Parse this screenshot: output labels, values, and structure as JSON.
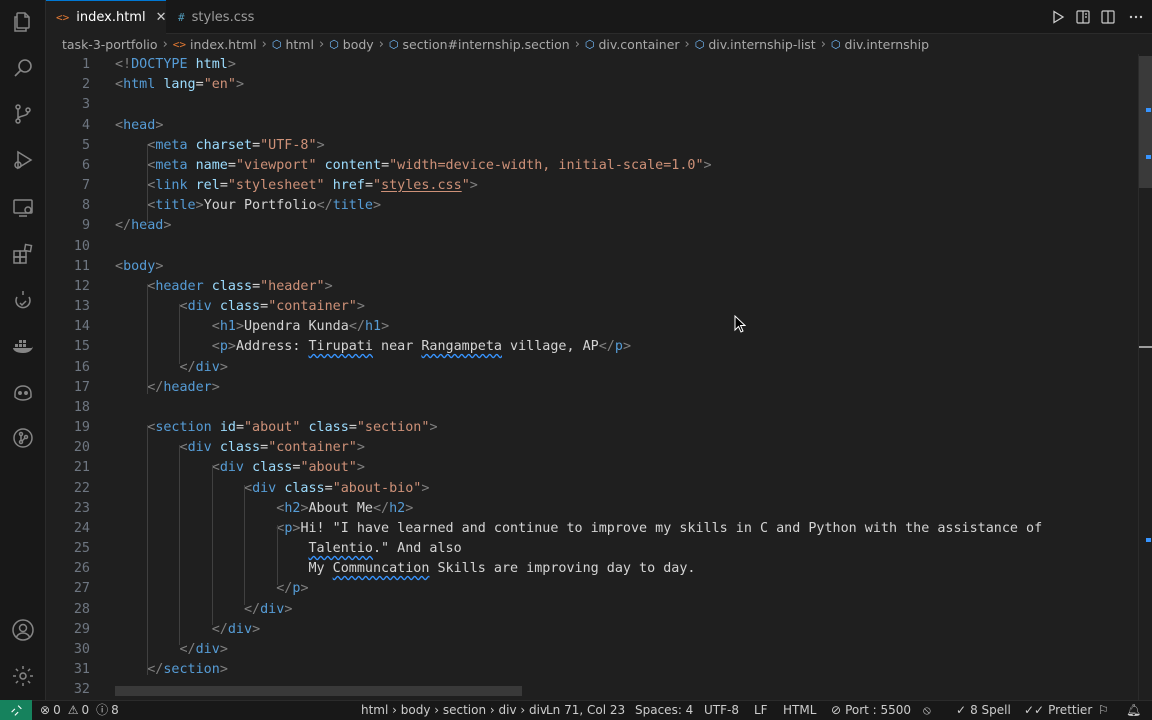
{
  "tabs": [
    {
      "label": "index.html",
      "icon": "<>",
      "active": true
    },
    {
      "label": "styles.css",
      "icon": "#",
      "active": false
    }
  ],
  "breadcrumbs": [
    "task-3-portfolio",
    "index.html",
    "html",
    "body",
    "section#internship.section",
    "div.container",
    "div.internship-list",
    "div.internship"
  ],
  "code_lines": [
    {
      "n": "1",
      "html": "<span class='tk-p'>&lt;!</span><span class='tk-t'>DOCTYPE</span> <span class='tk-a'>html</span><span class='tk-p'>&gt;</span>"
    },
    {
      "n": "2",
      "html": "<span class='tk-p'>&lt;</span><span class='tk-t'>html</span> <span class='tk-a'>lang</span><span class='tk-x'>=</span><span class='tk-s'>\"en\"</span><span class='tk-p'>&gt;</span>"
    },
    {
      "n": "3",
      "html": ""
    },
    {
      "n": "4",
      "html": "<span class='tk-p'>&lt;</span><span class='tk-t'>head</span><span class='tk-p'>&gt;</span>"
    },
    {
      "n": "5",
      "html": "    <span class='tk-p'>&lt;</span><span class='tk-t'>meta</span> <span class='tk-a'>charset</span><span class='tk-x'>=</span><span class='tk-s'>\"UTF-8\"</span><span class='tk-p'>&gt;</span>"
    },
    {
      "n": "6",
      "html": "    <span class='tk-p'>&lt;</span><span class='tk-t'>meta</span> <span class='tk-a'>name</span><span class='tk-x'>=</span><span class='tk-s'>\"viewport\"</span> <span class='tk-a'>content</span><span class='tk-x'>=</span><span class='tk-s'>\"width=device-width, initial-scale=1.0\"</span><span class='tk-p'>&gt;</span>"
    },
    {
      "n": "7",
      "html": "    <span class='tk-p'>&lt;</span><span class='tk-t'>link</span> <span class='tk-a'>rel</span><span class='tk-x'>=</span><span class='tk-s'>\"stylesheet\"</span> <span class='tk-a'>href</span><span class='tk-x'>=</span><span class='tk-s'>\"<span style='text-decoration:underline;text-underline-offset:2px'>styles.css</span>\"</span><span class='tk-p'>&gt;</span>"
    },
    {
      "n": "8",
      "html": "    <span class='tk-p'>&lt;</span><span class='tk-t'>title</span><span class='tk-p'>&gt;</span><span class='tk-x'>Your Portfolio</span><span class='tk-p'>&lt;/</span><span class='tk-t'>title</span><span class='tk-p'>&gt;</span>"
    },
    {
      "n": "9",
      "html": "<span class='tk-p'>&lt;/</span><span class='tk-t'>head</span><span class='tk-p'>&gt;</span>"
    },
    {
      "n": "10",
      "html": ""
    },
    {
      "n": "11",
      "html": "<span class='tk-p'>&lt;</span><span class='tk-t'>body</span><span class='tk-p'>&gt;</span>"
    },
    {
      "n": "12",
      "html": "    <span class='tk-p'>&lt;</span><span class='tk-t'>header</span> <span class='tk-a'>class</span><span class='tk-x'>=</span><span class='tk-s'>\"header\"</span><span class='tk-p'>&gt;</span>"
    },
    {
      "n": "13",
      "html": "        <span class='tk-p'>&lt;</span><span class='tk-t'>div</span> <span class='tk-a'>class</span><span class='tk-x'>=</span><span class='tk-s'>\"container\"</span><span class='tk-p'>&gt;</span>"
    },
    {
      "n": "14",
      "html": "            <span class='tk-p'>&lt;</span><span class='tk-t'>h1</span><span class='tk-p'>&gt;</span><span class='tk-x'>Upendra Kunda</span><span class='tk-p'>&lt;/</span><span class='tk-t'>h1</span><span class='tk-p'>&gt;</span>"
    },
    {
      "n": "15",
      "html": "            <span class='tk-p'>&lt;</span><span class='tk-t'>p</span><span class='tk-p'>&gt;</span><span class='tk-x'>Address: <span class='squig'>Tirupati</span> near <span class='squig'>Rangampeta</span> village, AP</span><span class='tk-p'>&lt;/</span><span class='tk-t'>p</span><span class='tk-p'>&gt;</span>"
    },
    {
      "n": "16",
      "html": "        <span class='tk-p'>&lt;/</span><span class='tk-t'>div</span><span class='tk-p'>&gt;</span>"
    },
    {
      "n": "17",
      "html": "    <span class='tk-p'>&lt;/</span><span class='tk-t'>header</span><span class='tk-p'>&gt;</span>"
    },
    {
      "n": "18",
      "html": ""
    },
    {
      "n": "19",
      "html": "    <span class='tk-p'>&lt;</span><span class='tk-t'>section</span> <span class='tk-a'>id</span><span class='tk-x'>=</span><span class='tk-s'>\"about\"</span> <span class='tk-a'>class</span><span class='tk-x'>=</span><span class='tk-s'>\"section\"</span><span class='tk-p'>&gt;</span>"
    },
    {
      "n": "20",
      "html": "        <span class='tk-p'>&lt;</span><span class='tk-t'>div</span> <span class='tk-a'>class</span><span class='tk-x'>=</span><span class='tk-s'>\"container\"</span><span class='tk-p'>&gt;</span>"
    },
    {
      "n": "21",
      "html": "            <span class='tk-p'>&lt;</span><span class='tk-t'>div</span> <span class='tk-a'>class</span><span class='tk-x'>=</span><span class='tk-s'>\"about\"</span><span class='tk-p'>&gt;</span>"
    },
    {
      "n": "22",
      "html": "                <span class='tk-p'>&lt;</span><span class='tk-t'>div</span> <span class='tk-a'>class</span><span class='tk-x'>=</span><span class='tk-s'>\"about-bio\"</span><span class='tk-p'>&gt;</span>"
    },
    {
      "n": "23",
      "html": "                    <span class='tk-p'>&lt;</span><span class='tk-t'>h2</span><span class='tk-p'>&gt;</span><span class='tk-x'>About Me</span><span class='tk-p'>&lt;/</span><span class='tk-t'>h2</span><span class='tk-p'>&gt;</span>"
    },
    {
      "n": "24",
      "html": "                    <span class='tk-p'>&lt;</span><span class='tk-t'>p</span><span class='tk-p'>&gt;</span><span class='tk-x'>Hi! \"I have learned and continue to improve my skills in C and Python with the assistance of</span>"
    },
    {
      "n": "25",
      "html": "                        <span class='tk-x'><span class='squig'>Talentio</span>.\" And also</span>"
    },
    {
      "n": "26",
      "html": "                        <span class='tk-x'>My <span class='squig'>Communcation</span> Skills are improving day to day.</span>"
    },
    {
      "n": "27",
      "html": "                    <span class='tk-p'>&lt;/</span><span class='tk-t'>p</span><span class='tk-p'>&gt;</span>"
    },
    {
      "n": "28",
      "html": "                <span class='tk-p'>&lt;/</span><span class='tk-t'>div</span><span class='tk-p'>&gt;</span>"
    },
    {
      "n": "29",
      "html": "            <span class='tk-p'>&lt;/</span><span class='tk-t'>div</span><span class='tk-p'>&gt;</span>"
    },
    {
      "n": "30",
      "html": "        <span class='tk-p'>&lt;/</span><span class='tk-t'>div</span><span class='tk-p'>&gt;</span>"
    },
    {
      "n": "31",
      "html": "    <span class='tk-p'>&lt;/</span><span class='tk-t'>section</span><span class='tk-p'>&gt;</span>"
    },
    {
      "n": "32",
      "html": ""
    }
  ],
  "status": {
    "errors": "0",
    "warnings": "0",
    "info": "8",
    "path": "html › body › section › div › div",
    "position": "Ln 71, Col 23",
    "spaces": "Spaces: 4",
    "encoding": "UTF-8",
    "eol": "LF",
    "language": "HTML",
    "port": "Port : 5500",
    "spell": "8 Spell",
    "prettier": "Prettier"
  },
  "colors": {
    "accent": "#0078d4",
    "remote": "#16825d",
    "tag": "#569cd6",
    "attr": "#9cdcfe",
    "string": "#ce9178"
  }
}
